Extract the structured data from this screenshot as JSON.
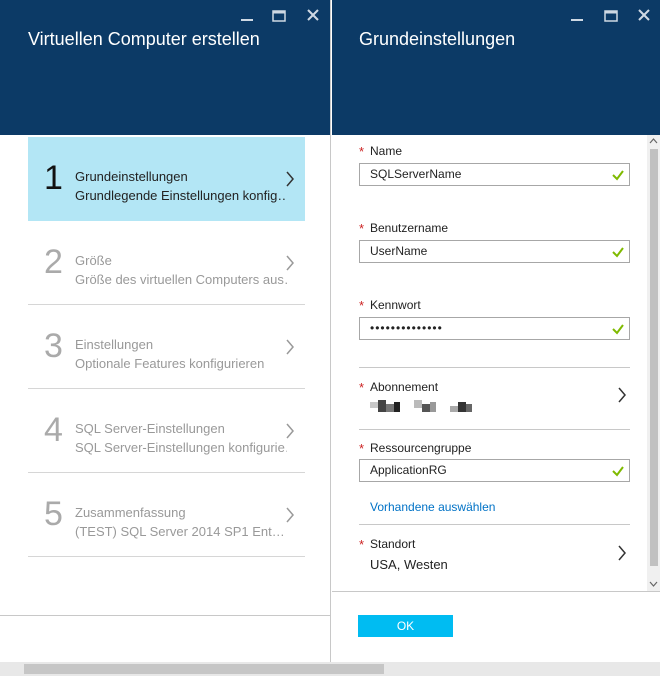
{
  "left_blade": {
    "title": "Virtuellen Computer erstellen",
    "steps": [
      {
        "num": "1",
        "title": "Grundeinstellungen",
        "subtitle": "Grundlegende Einstellungen konfig…"
      },
      {
        "num": "2",
        "title": "Größe",
        "subtitle": "Größe des virtuellen Computers aus…"
      },
      {
        "num": "3",
        "title": "Einstellungen",
        "subtitle": "Optionale Features konfigurieren"
      },
      {
        "num": "4",
        "title": "SQL Server-Einstellungen",
        "subtitle": "SQL Server-Einstellungen konfigurie…"
      },
      {
        "num": "5",
        "title": "Zusammenfassung",
        "subtitle": "(TEST) SQL Server 2014 SP1 Ent…"
      }
    ]
  },
  "right_blade": {
    "title": "Grundeinstellungen",
    "fields": {
      "name": {
        "label": "Name",
        "value": "SQLServerName"
      },
      "username": {
        "label": "Benutzername",
        "value": "UserName"
      },
      "password": {
        "label": "Kennwort",
        "value": "••••••••••••••"
      },
      "subscription": {
        "label": "Abonnement"
      },
      "resource_group": {
        "label": "Ressourcengruppe",
        "value": "ApplicationRG",
        "link": "Vorhandene auswählen"
      },
      "location": {
        "label": "Standort",
        "value": "USA, Westen"
      }
    },
    "ok_label": "OK"
  },
  "window_controls": {
    "minimize": "_",
    "maximize": "☐",
    "close": "✕"
  },
  "colors": {
    "header": "#0c3a66",
    "active_step": "#b3e6f5",
    "ok_button": "#00bcf2",
    "check": "#7fba00",
    "link": "#0072c6",
    "required": "#cc2222"
  }
}
